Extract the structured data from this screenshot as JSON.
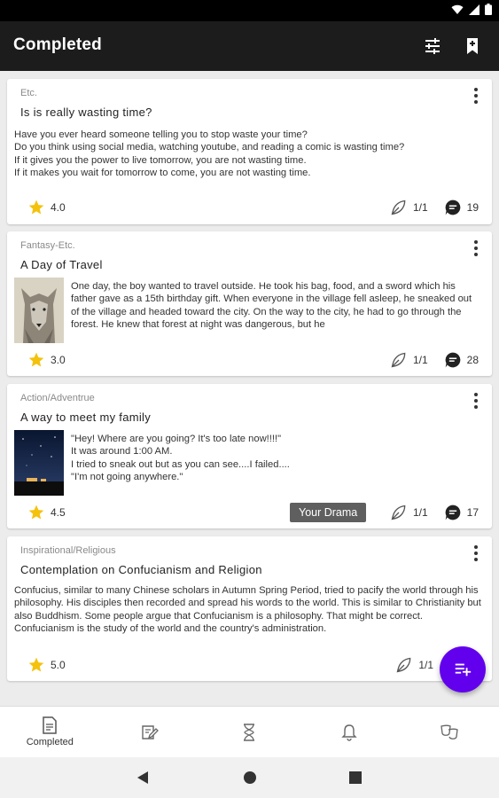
{
  "appbar": {
    "title": "Completed",
    "filter_icon": "tune-icon",
    "bookmark_icon": "bookmark-icon"
  },
  "posts": [
    {
      "genre": "Etc.",
      "title": "Is is really wasting time?",
      "body": "Have you ever heard someone telling you to stop waste your time?\nDo you think using social media, watching youtube, and reading a comic is wasting time?\nIf it gives you the power to live tomorrow, you are not wasting time.\nIf it makes you wait for tomorrow to come, you are not wasting time.",
      "rating": "4.0",
      "episodes": "1/1",
      "comments": "19"
    },
    {
      "genre": "Fantasy-Etc.",
      "title": "A Day of Travel",
      "body": "One day, the boy wanted to travel outside. He took his bag, food, and a sword which his father gave as a 15th birthday gift. When everyone in the village fell asleep, he sneaked out of the village and headed toward the city. On the way to the city, he had to go through the forest. He knew that forest at night was dangerous, but he",
      "image": "wolf-photo",
      "rating": "3.0",
      "episodes": "1/1",
      "comments": "28"
    },
    {
      "genre": "Action/Adventrue",
      "title": "A way to meet my family",
      "body": "\"Hey! Where are you going? It's too late now!!!!\"\nIt was around 1:00 AM.\nI tried to sneak out but as you can see....I failed....\n\"I'm not going anywhere.\"",
      "image": "night-sky-photo",
      "rating": "4.5",
      "episodes": "1/1",
      "comments": "17",
      "tooltip": "Your Drama"
    },
    {
      "genre": "Inspirational/Religious",
      "title": "Contemplation on Confucianism and Religion",
      "body": "Confucius, similar to many Chinese scholars in Autumn Spring Period, tried to pacify the world through his philosophy. His disciples then recorded and spread his words to the world. This is similar to Christianity but also Buddhism. Some people argue that Confucianism is a philosophy. That might be correct. Confucianism is the study of the world and the country's administration.",
      "rating": "5.0",
      "episodes": "1/1"
    }
  ],
  "fab_icon": "playlist-add-icon",
  "bottom_nav": [
    {
      "label": "Completed",
      "icon": "document-icon"
    },
    {
      "label": "",
      "icon": "edit-note-icon"
    },
    {
      "label": "",
      "icon": "hourglass-icon"
    },
    {
      "label": "",
      "icon": "bell-icon"
    },
    {
      "label": "",
      "icon": "drama-masks-icon"
    }
  ],
  "colors": {
    "appbar": "#1c1c1c",
    "accent": "#6200ee",
    "star": "#f4c20d"
  }
}
